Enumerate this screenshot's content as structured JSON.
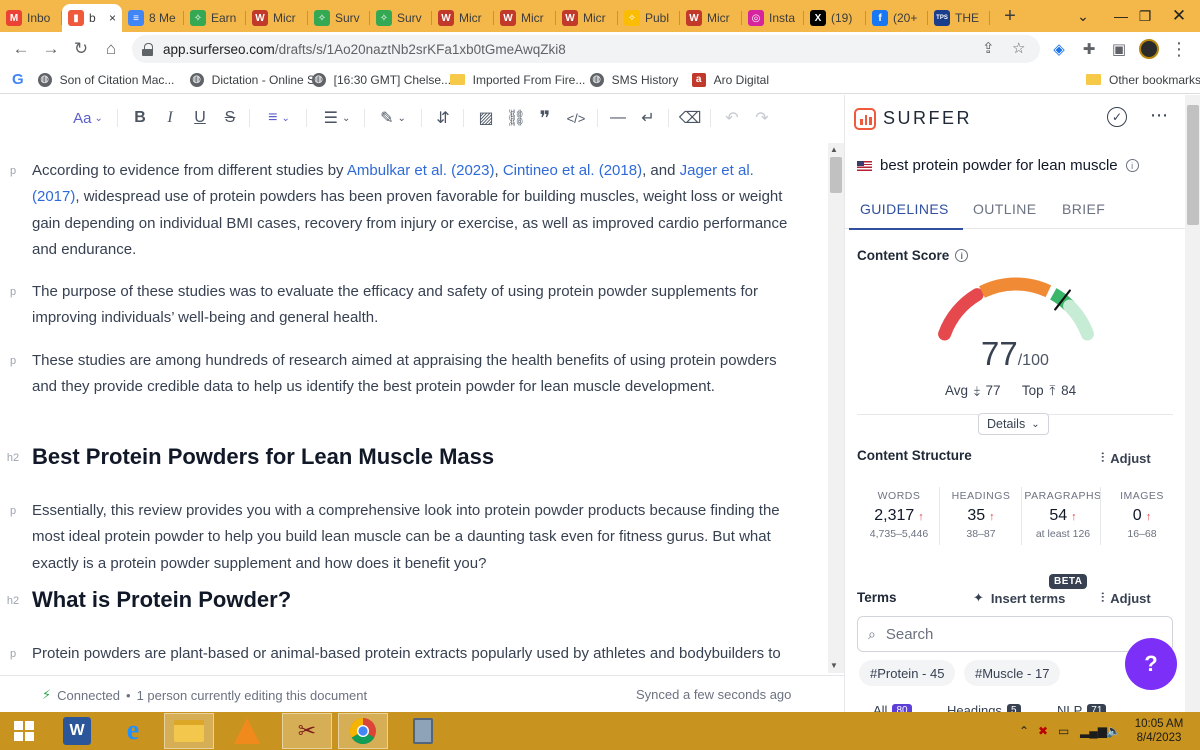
{
  "browser": {
    "tabs": [
      {
        "label": "Inbo",
        "icon": "gmail",
        "color": "#ea4335"
      },
      {
        "label": "b",
        "icon": "surfer",
        "color": "#ef5a3c",
        "active": true
      },
      {
        "label": "8 Me",
        "icon": "docs",
        "color": "#4285f4"
      },
      {
        "label": "Earn",
        "icon": "puzzle",
        "color": "#34a853"
      },
      {
        "label": "Micr",
        "icon": "w",
        "color": "#c0392b"
      },
      {
        "label": "Surv",
        "icon": "puzzle",
        "color": "#34a853"
      },
      {
        "label": "Surv",
        "icon": "puzzle",
        "color": "#34a853"
      },
      {
        "label": "Micr",
        "icon": "w",
        "color": "#c0392b"
      },
      {
        "label": "Micr",
        "icon": "w",
        "color": "#c0392b"
      },
      {
        "label": "Micr",
        "icon": "w",
        "color": "#c0392b"
      },
      {
        "label": "Publ",
        "icon": "puzzle",
        "color": "#fbbc04"
      },
      {
        "label": "Micr",
        "icon": "w",
        "color": "#c0392b"
      },
      {
        "label": "Insta",
        "icon": "instagram",
        "color": "#d6249f"
      },
      {
        "label": "(19)",
        "icon": "x",
        "color": "#000000"
      },
      {
        "label": "(20+",
        "icon": "facebook",
        "color": "#1877f2"
      },
      {
        "label": "THE",
        "icon": "tps",
        "color": "#1a3e8c"
      }
    ],
    "tab_close": "×",
    "new_tab": "+",
    "url_host": "app.surferseo.com",
    "url_path": "/drafts/s/1Ao20naztNb2srKFa1xb0tGmeAwqZki8",
    "bookmarks": [
      {
        "label": "Son of Citation Mac...",
        "type": "globe"
      },
      {
        "label": "Dictation - Online S...",
        "type": "globe"
      },
      {
        "label": "[16:30 GMT] Chelse...",
        "type": "globe"
      },
      {
        "label": "Imported From Fire...",
        "type": "folder"
      },
      {
        "label": "SMS History",
        "type": "globe"
      },
      {
        "label": "Aro Digital",
        "type": "aro"
      }
    ],
    "other_bookmarks": "Other bookmarks"
  },
  "editor": {
    "toolbar": {
      "font": "Aa"
    },
    "blocks": [
      {
        "tag": "p",
        "parts": [
          {
            "t": "According to evidence from different studies by "
          },
          {
            "t": "Ambulkar et al. (2023)",
            "link": true
          },
          {
            "t": ", "
          },
          {
            "t": "Cintineo et al. (2018)",
            "link": true
          },
          {
            "t": ", and "
          },
          {
            "t": "Jager et al. (2017)",
            "link": true
          },
          {
            "t": ", widespread use of protein powders has been proven favorable for building muscles, weight loss or weight gain depending on individual BMI cases, recovery from injury or exercise, as well as improved cardio performance and endurance."
          }
        ]
      },
      {
        "tag": "p",
        "text": "The purpose of these studies was to evaluate the efficacy and safety of using protein powder supplements for improving individuals’ well-being and general health."
      },
      {
        "tag": "p",
        "text": "These studies are among hundreds of research aimed at appraising the health benefits of using protein powders and they provide credible data to help us identify the best protein powder for lean muscle development."
      },
      {
        "tag": "h2",
        "text": "Best Protein Powders for Lean Muscle Mass"
      },
      {
        "tag": "p",
        "text": "Essentially, this review provides you with a comprehensive look into protein powder products because finding the most ideal protein powder to help you build lean muscle can be a daunting task even for fitness gurus. But what exactly is a protein powder supplement and how does it benefit you?"
      },
      {
        "tag": "h2",
        "text": "What is Protein Powder?"
      },
      {
        "tag": "p",
        "text": "Protein powders are plant-based or animal-based protein extracts popularly used by athletes and bodybuilders to enhance physical performance and optimize general muscle health; including muscle repair"
      }
    ],
    "status_connected": "Connected",
    "status_editing": "1 person currently editing this document",
    "status_synced": "Synced a few seconds ago"
  },
  "surfer": {
    "brand": "SURFER",
    "keyword": "best protein powder for lean muscle",
    "tabs": [
      "GUIDELINES",
      "OUTLINE",
      "BRIEF"
    ],
    "content_score_label": "Content Score",
    "score": 77,
    "score_max": 100,
    "score_max_text": "/100",
    "avg_label": "Avg",
    "avg_value": "77",
    "top_label": "Top",
    "top_value": "84",
    "details_label": "Details",
    "content_structure_label": "Content Structure",
    "adjust_label": "Adjust",
    "stats": [
      {
        "label": "WORDS",
        "value": "2,317",
        "range": "4,735–5,446"
      },
      {
        "label": "HEADINGS",
        "value": "35",
        "range": "38–87"
      },
      {
        "label": "PARAGRAPHS",
        "value": "54",
        "range": "at least 126"
      },
      {
        "label": "IMAGES",
        "value": "0",
        "range": "16–68"
      }
    ],
    "terms_label": "Terms",
    "insert_terms_label": "Insert terms",
    "beta_label": "BETA",
    "search_placeholder": "Search",
    "chips": [
      "#Protein - 45",
      "#Muscle - 17"
    ],
    "filters": [
      {
        "label": "All",
        "count": "80"
      },
      {
        "label": "Headings",
        "count": "5"
      },
      {
        "label": "NLP",
        "count": "71"
      }
    ],
    "help": "?"
  },
  "taskbar": {
    "time": "10:05 AM",
    "date": "8/4/2023"
  },
  "colors": {
    "tabstrip": "#f4b84a",
    "surfer_accent": "#2f4f9f",
    "gauge_red": "#e5484d",
    "gauge_orange": "#f08a35",
    "gauge_green": "#3cb66a",
    "gauge_light": "#c7ecd5",
    "help_purple": "#7b2ff7"
  }
}
